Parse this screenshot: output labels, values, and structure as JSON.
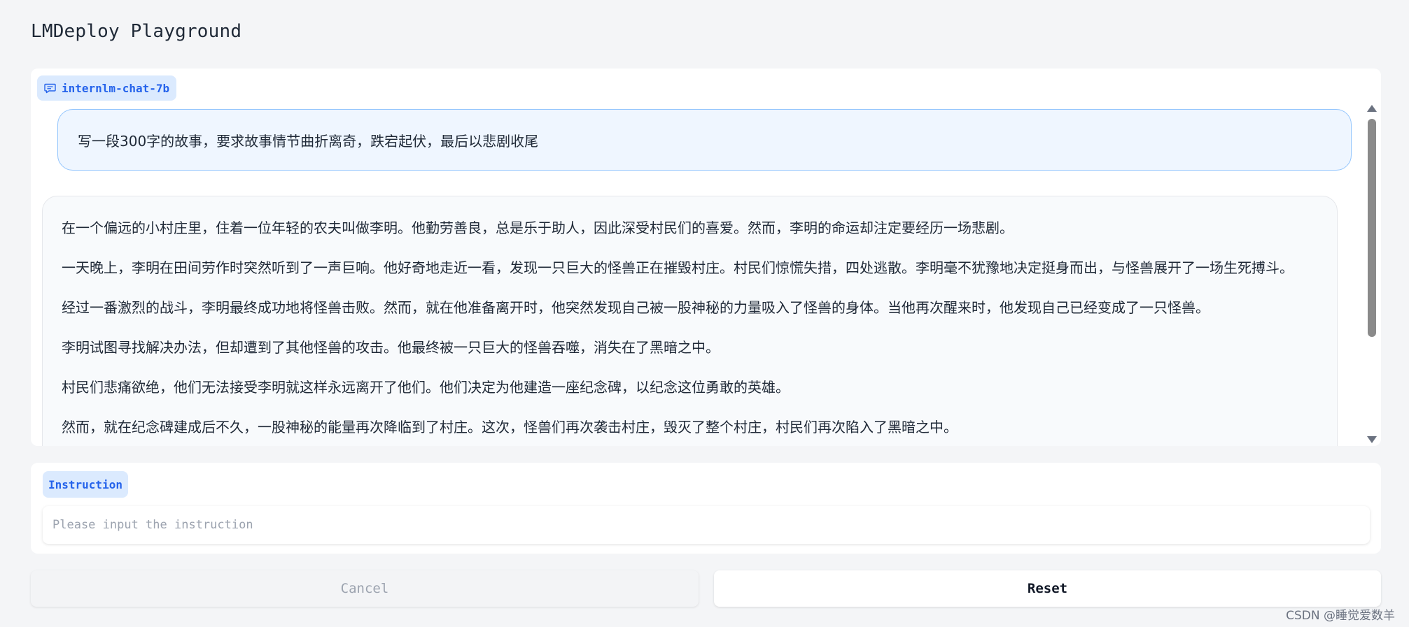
{
  "app": {
    "title": "LMDeploy Playground"
  },
  "chat": {
    "model_label": "internlm-chat-7b",
    "user_message": "写一段300字的故事，要求故事情节曲折离奇，跌宕起伏，最后以悲剧收尾",
    "bot_paragraphs": [
      "在一个偏远的小村庄里，住着一位年轻的农夫叫做李明。他勤劳善良，总是乐于助人，因此深受村民们的喜爱。然而，李明的命运却注定要经历一场悲剧。",
      "一天晚上，李明在田间劳作时突然听到了一声巨响。他好奇地走近一看，发现一只巨大的怪兽正在摧毁村庄。村民们惊慌失措，四处逃散。李明毫不犹豫地决定挺身而出，与怪兽展开了一场生死搏斗。",
      "经过一番激烈的战斗，李明最终成功地将怪兽击败。然而，就在他准备离开时，他突然发现自己被一股神秘的力量吸入了怪兽的身体。当他再次醒来时，他发现自己已经变成了一只怪兽。",
      "李明试图寻找解决办法，但却遭到了其他怪兽的攻击。他最终被一只巨大的怪兽吞噬，消失在了黑暗之中。",
      "村民们悲痛欲绝，他们无法接受李明就这样永远离开了他们。他们决定为他建造一座纪念碑，以纪念这位勇敢的英雄。",
      "然而，就在纪念碑建成后不久，一股神秘的能量再次降临到了村庄。这次，怪兽们再次袭击村庄，毁灭了整个村庄，村民们再次陷入了黑暗之中。"
    ]
  },
  "instruction": {
    "label": "Instruction",
    "placeholder": "Please input the instruction",
    "value": ""
  },
  "buttons": {
    "cancel": "Cancel",
    "reset": "Reset"
  },
  "watermark": "CSDN @睡觉爱数羊"
}
